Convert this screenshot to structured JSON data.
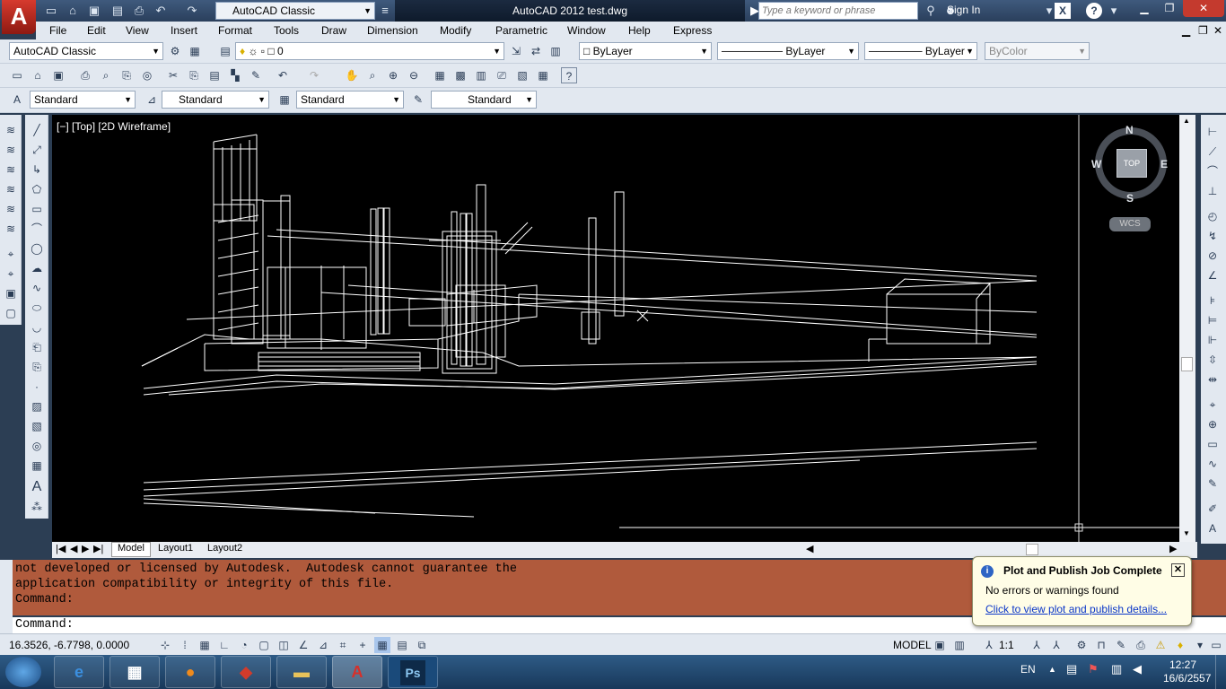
{
  "titlebar": {
    "title": "AutoCAD 2012    test.dwg",
    "workspace": "AutoCAD Classic",
    "search_placeholder": "Type a keyword or phrase",
    "sign_in": "Sign In"
  },
  "menu": [
    "File",
    "Edit",
    "View",
    "Insert",
    "Format",
    "Tools",
    "Draw",
    "Dimension",
    "Modify",
    "Parametric",
    "Window",
    "Help",
    "Express"
  ],
  "toolbar1": {
    "workspace": "AutoCAD Classic",
    "layer": "0",
    "color": "ByLayer",
    "linetype": "ByLayer",
    "lineweight": "ByLayer",
    "plotstyle": "ByColor"
  },
  "toolbar3": {
    "text_style": "Standard",
    "dim_style": "Standard",
    "table_style": "Standard",
    "mleader_style": "Standard"
  },
  "viewport": {
    "label": "[−] [Top] [2D Wireframe]"
  },
  "viewcube": {
    "n": "N",
    "s": "S",
    "e": "E",
    "w": "W",
    "face": "TOP",
    "wcs": "WCS"
  },
  "layout_tabs": [
    "Model",
    "Layout1",
    "Layout2"
  ],
  "command": {
    "history": [
      "not developed or licensed by Autodesk.  Autodesk cannot guarantee the",
      "application compatibility or integrity of this file.",
      "Command:"
    ],
    "prompt": "Command:"
  },
  "statusbar": {
    "coords": "16.3526, -6.7798, 0.0000",
    "model": "MODEL",
    "scale": "1:1"
  },
  "balloon": {
    "title": "Plot and Publish Job Complete",
    "message": "No errors or warnings found",
    "link": "Click to view plot and publish details..."
  },
  "taskbar": {
    "lang": "EN",
    "time": "12:27",
    "date": "16/6/2557",
    "apps": [
      "ie",
      "calculator",
      "firefox",
      "sketchup",
      "explorer",
      "autocad",
      "photoshop"
    ],
    "ps_label": "Ps"
  }
}
